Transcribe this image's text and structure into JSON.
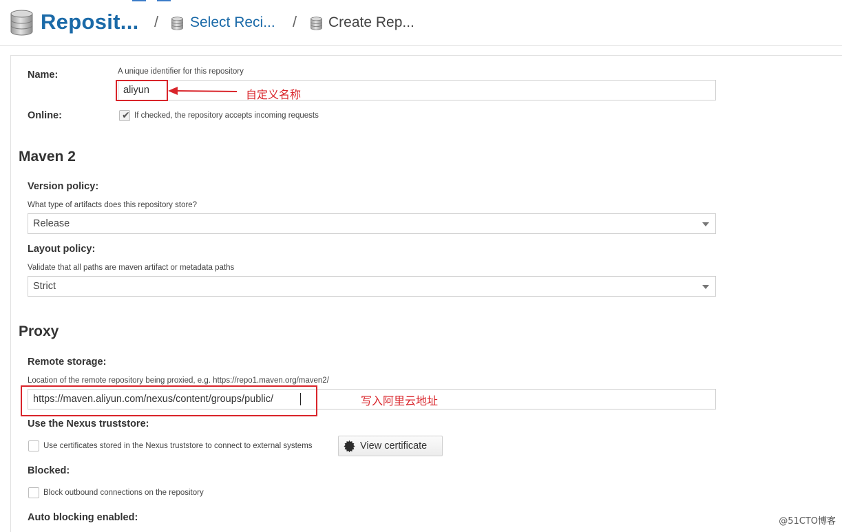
{
  "breadcrumb": {
    "root": "Reposit...",
    "separator": "/",
    "recipe": "Select Reci...",
    "current": "Create Rep..."
  },
  "form": {
    "name": {
      "label": "Name:",
      "help": "A unique identifier for this repository",
      "value": "aliyun"
    },
    "online": {
      "label": "Online:",
      "checked": true,
      "text": "If checked, the repository accepts incoming requests"
    }
  },
  "maven": {
    "title": "Maven 2",
    "version_policy": {
      "label": "Version policy:",
      "help": "What type of artifacts does this repository store?",
      "value": "Release"
    },
    "layout_policy": {
      "label": "Layout policy:",
      "help": "Validate that all paths are maven artifact or metadata paths",
      "value": "Strict"
    }
  },
  "proxy": {
    "title": "Proxy",
    "remote_storage": {
      "label": "Remote storage:",
      "help": "Location of the remote repository being proxied, e.g. https://repo1.maven.org/maven2/",
      "value": "https://maven.aliyun.com/nexus/content/groups/public/"
    },
    "truststore": {
      "label": "Use the Nexus truststore:",
      "checked": false,
      "text": "Use certificates stored in the Nexus truststore to connect to external systems",
      "button": "View certificate"
    },
    "blocked": {
      "label": "Blocked:",
      "checked": false,
      "text": "Block outbound connections on the repository"
    },
    "auto_blocking": {
      "label": "Auto blocking enabled:"
    }
  },
  "annotations": {
    "name_note": "自定义名称",
    "url_note": "写入阿里云地址",
    "color": "#d9242a"
  },
  "watermark": "@51CTO博客",
  "colors": {
    "link_blue": "#1b6aa8",
    "text": "#333333",
    "border": "#cfcfcf"
  }
}
